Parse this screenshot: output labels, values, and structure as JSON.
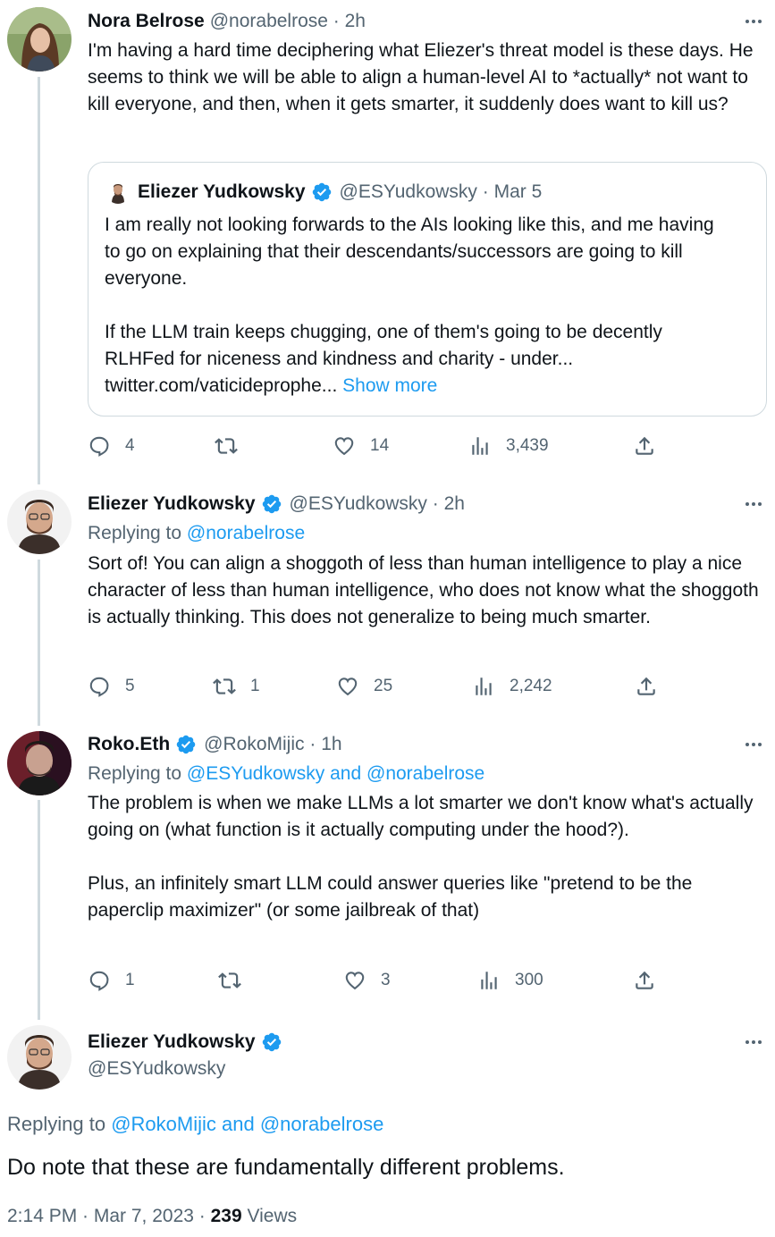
{
  "tweets": [
    {
      "name": "Nora Belrose",
      "handle": "@norabelrose",
      "time": "2h",
      "text": "I'm having a hard time deciphering what Eliezer's threat model is these days. He seems to think we will be able to align a human-level AI to *actually* not want to kill everyone, and then, when it gets smarter, it suddenly does want to kill us?",
      "quote": {
        "name": "Eliezer Yudkowsky",
        "handle": "@ESYudkowsky",
        "time": "Mar 5",
        "text": "I am really not looking forwards to the AIs looking like this, and me having to go on explaining that their descendants/successors are going to kill everyone.\n\nIf the LLM train keeps chugging, one of them's going to be decently RLHFed for niceness and kindness and charity - under... twitter.com/vaticideprophe...",
        "show_more": "Show more"
      },
      "replies": "4",
      "retweets": "",
      "likes": "14",
      "views": "3,439"
    },
    {
      "name": "Eliezer Yudkowsky",
      "handle": "@ESYudkowsky",
      "time": "2h",
      "replying_prefix": "Replying to",
      "replying_to": "@norabelrose",
      "text": "Sort of! You can align a shoggoth of less than human intelligence to play a nice character of less than human intelligence, who does not know what the shoggoth is actually thinking. This does not generalize to being much smarter.",
      "replies": "5",
      "retweets": "1",
      "likes": "25",
      "views": "2,242"
    },
    {
      "name": "Roko.Eth",
      "handle": "@RokoMijic",
      "time": "1h",
      "replying_prefix": "Replying to",
      "replying_to": "@ESYudkowsky and @norabelrose",
      "text": "The problem is when we make LLMs a lot smarter we don't know what's actually going on (what function is it actually computing under the hood?).\n\nPlus, an infinitely smart LLM could answer queries like \"pretend to be the paperclip maximizer\" (or some jailbreak of that)",
      "replies": "1",
      "retweets": "",
      "likes": "3",
      "views": "300"
    }
  ],
  "main": {
    "name": "Eliezer Yudkowsky",
    "handle": "@ESYudkowsky",
    "replying_prefix": "Replying to",
    "replying_to": "@RokoMijic and @norabelrose",
    "text": "Do note that these are fundamentally different problems.",
    "timestamp": "2:14 PM · Mar 7, 2023 · ",
    "views_count": "239",
    "views_label": " Views"
  },
  "colors": {
    "accent": "#1d9bf0",
    "secondary_text": "#536471",
    "thread_line": "#cfd9de"
  }
}
